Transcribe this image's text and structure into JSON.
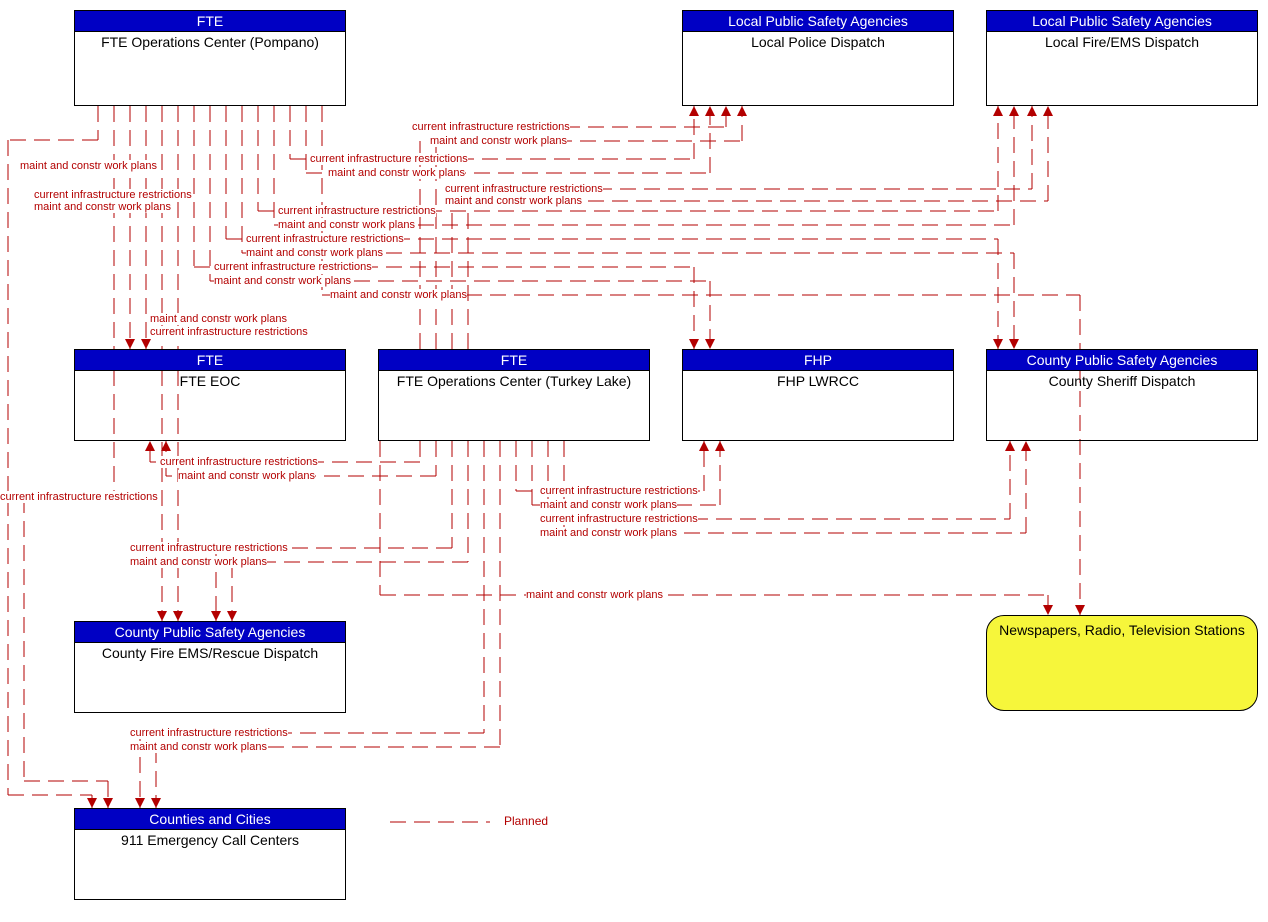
{
  "nodes": {
    "pompano": {
      "header": "FTE",
      "body": "FTE Operations Center (Pompano)"
    },
    "localPolice": {
      "header": "Local Public Safety Agencies",
      "body": "Local Police Dispatch"
    },
    "localFire": {
      "header": "Local Public Safety Agencies",
      "body": "Local Fire/EMS Dispatch"
    },
    "fteEoc": {
      "header": "FTE",
      "body": "FTE EOC"
    },
    "turkeyLake": {
      "header": "FTE",
      "body": "FTE Operations Center (Turkey Lake)"
    },
    "fhpLwrcc": {
      "header": "FHP",
      "body": "FHP LWRCC"
    },
    "countySheriff": {
      "header": "County Public Safety Agencies",
      "body": "County Sheriff Dispatch"
    },
    "countyFire": {
      "header": "County Public Safety Agencies",
      "body": "County Fire EMS/Rescue Dispatch"
    },
    "callCenters": {
      "header": "Counties and Cities",
      "body": "911 Emergency Call Centers"
    },
    "media": {
      "body": "Newspapers, Radio, Television Stations"
    }
  },
  "flowText": {
    "cir": "current infrastructure restrictions",
    "mcwp": "maint and constr work plans"
  },
  "legend": {
    "planned": "Planned"
  }
}
